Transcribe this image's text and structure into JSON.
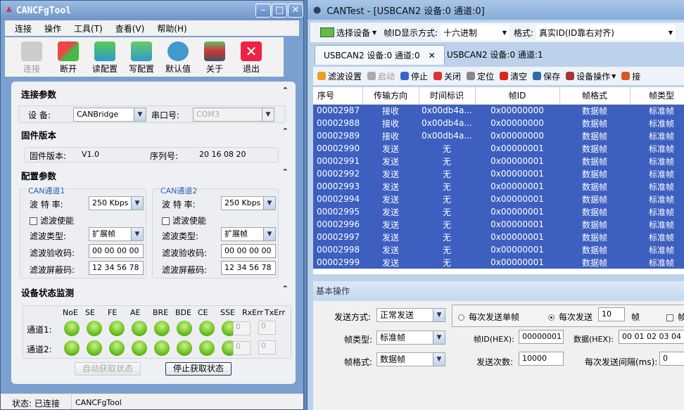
{
  "left": {
    "title": "CANCFgTool",
    "menu": [
      "连接",
      "操作",
      "工具(T)",
      "查看(V)",
      "帮助(H)"
    ],
    "toolbar": [
      {
        "label": "连接",
        "icon": "connect-icon",
        "disabled": true
      },
      {
        "label": "断开",
        "icon": "disconnect-icon"
      },
      {
        "label": "读配置",
        "icon": "read-config-icon"
      },
      {
        "label": "写配置",
        "icon": "write-config-icon"
      },
      {
        "label": "默认值",
        "icon": "gears-icon"
      },
      {
        "label": "关于",
        "icon": "about-icon"
      },
      {
        "label": "退出",
        "icon": "exit-icon"
      }
    ],
    "conn": {
      "title": "连接参数",
      "device_label": "设    备:",
      "device": "CANBridge",
      "port_label": "串口号:",
      "port": "COM3"
    },
    "fw": {
      "title": "固件版本",
      "ver_label": "固件版本:",
      "ver": "V1.0",
      "sn_label": "序列号:",
      "sn": "20 16 08 20"
    },
    "cfg": {
      "title": "配置参数",
      "channels": [
        {
          "name": "CAN通道1",
          "baud_label": "波 特 率:",
          "baud": "250 Kbps",
          "filter_enable": "滤波使能",
          "ftype_label": "滤波类型:",
          "ftype": "扩展帧",
          "code_label": "滤波验收码:",
          "code": "00 00 00 00",
          "mask_label": "滤波屏蔽码:",
          "mask": "12 34 56 78"
        },
        {
          "name": "CAN通道2",
          "baud_label": "波 特 率:",
          "baud": "250 Kbps",
          "filter_enable": "滤波使能",
          "ftype_label": "滤波类型:",
          "ftype": "扩展帧",
          "code_label": "滤波验收码:",
          "code": "00 00 00 00",
          "mask_label": "滤波屏蔽码:",
          "mask": "12 34 56 78"
        }
      ]
    },
    "mon": {
      "title": "设备状态监测",
      "cols": [
        "NoE",
        "SE",
        "FE",
        "AE",
        "BRE",
        "BDE",
        "CE",
        "SSE",
        "RxErr",
        "TxErr"
      ],
      "rows": [
        {
          "label": "通道1:",
          "rx": "0",
          "tx": "0"
        },
        {
          "label": "通道2:",
          "rx": "0",
          "tx": "0"
        }
      ],
      "auto_btn": "自动获取状态",
      "stop_btn": "停止获取状态",
      "led_color": "#6cc21e"
    },
    "status": {
      "state": "状态: 已连接",
      "app": "CANCFgTool"
    }
  },
  "right": {
    "title": "CANTest - [USBCAN2 设备:0 通道:0]",
    "select_device": "选择设备",
    "id_mode_label": "帧ID显示方式:",
    "id_mode": "十六进制",
    "format_label": "格式:",
    "format": "真实ID(ID靠右对齐)",
    "tabs": [
      "USBCAN2 设备:0 通道:0",
      "USBCAN2 设备:0 通道:1"
    ],
    "tools": [
      "滤波设置",
      "启动",
      "停止",
      "关闭",
      "定位",
      "清空",
      "保存",
      "设备操作",
      "接"
    ],
    "columns": [
      "序号",
      "传输方向",
      "时间标识",
      "帧ID",
      "帧格式",
      "帧类型"
    ],
    "rows": [
      [
        "00002987",
        "接收",
        "0x00db4a...",
        "0x00000000",
        "数据帧",
        "标准帧"
      ],
      [
        "00002988",
        "接收",
        "0x00db4a...",
        "0x00000000",
        "数据帧",
        "标准帧"
      ],
      [
        "00002989",
        "接收",
        "0x00db4a...",
        "0x00000000",
        "数据帧",
        "标准帧"
      ],
      [
        "00002990",
        "发送",
        "无",
        "0x00000001",
        "数据帧",
        "标准帧"
      ],
      [
        "00002991",
        "发送",
        "无",
        "0x00000001",
        "数据帧",
        "标准帧"
      ],
      [
        "00002992",
        "发送",
        "无",
        "0x00000001",
        "数据帧",
        "标准帧"
      ],
      [
        "00002993",
        "发送",
        "无",
        "0x00000001",
        "数据帧",
        "标准帧"
      ],
      [
        "00002994",
        "发送",
        "无",
        "0x00000001",
        "数据帧",
        "标准帧"
      ],
      [
        "00002995",
        "发送",
        "无",
        "0x00000001",
        "数据帧",
        "标准帧"
      ],
      [
        "00002996",
        "发送",
        "无",
        "0x00000001",
        "数据帧",
        "标准帧"
      ],
      [
        "00002997",
        "发送",
        "无",
        "0x00000001",
        "数据帧",
        "标准帧"
      ],
      [
        "00002998",
        "发送",
        "无",
        "0x00000001",
        "数据帧",
        "标准帧"
      ],
      [
        "00002999",
        "发送",
        "无",
        "0x00000001",
        "数据帧",
        "标准帧"
      ]
    ],
    "basic": {
      "title": "基本操作",
      "send_mode_label": "发送方式:",
      "send_mode": "正常发送",
      "single": "每次发送单帧",
      "multi": "每次发送",
      "multi_count": "10",
      "frame_unit": "帧",
      "cut": "帧",
      "ftype_label": "帧类型:",
      "ftype": "标准帧",
      "fid_label": "帧ID(HEX):",
      "fid": "00000001",
      "data_label": "数据(HEX):",
      "data": "00 01 02 03 04",
      "fformat_label": "帧格式:",
      "fformat": "数据帧",
      "count_label": "发送次数:",
      "count": "10000",
      "interval_label": "每次发送间隔(ms):",
      "interval": "0"
    }
  }
}
